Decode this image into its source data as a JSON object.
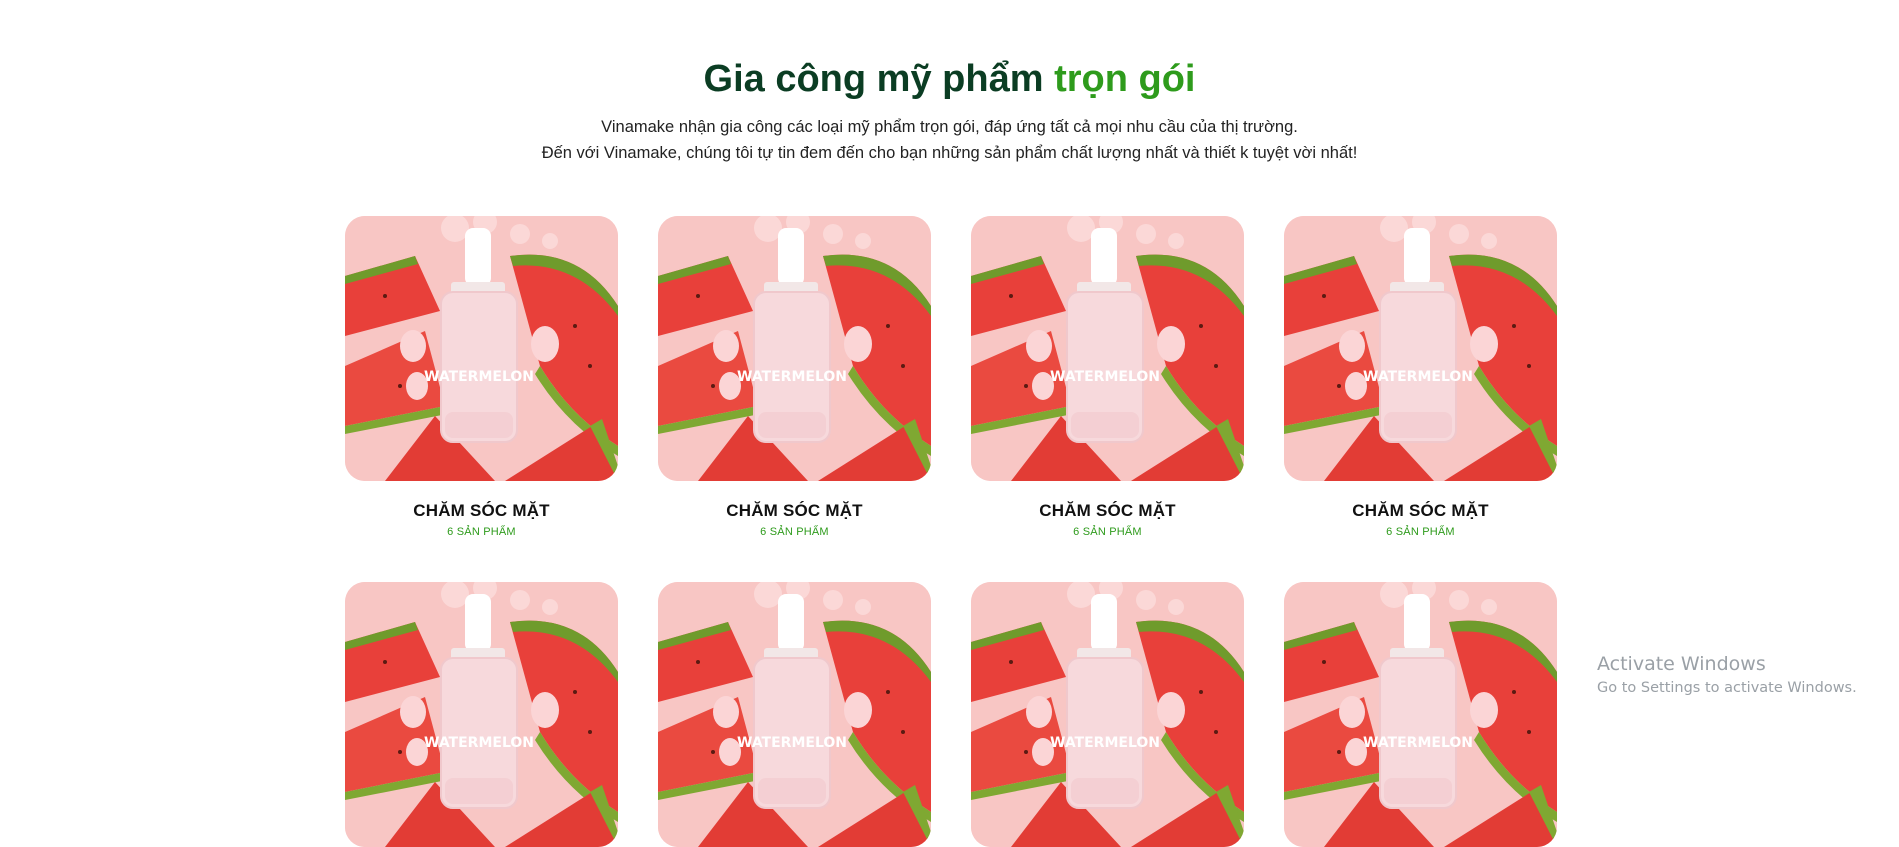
{
  "section": {
    "title_main": "Gia công mỹ phẩm",
    "title_accent": "trọn gói",
    "subtitle_line1": "Vinamake nhận gia công các loại mỹ phẩm trọn gói, đáp ứng tất cả mọi nhu cầu của thị trường.",
    "subtitle_line2": "Đến với Vinamake, chúng tôi tự tin đem đến cho bạn những sản phẩm chất lượng nhất và thiết k tuyệt vời nhất!"
  },
  "categories": [
    {
      "title": "CHĂM SÓC MẶT",
      "count": "6 SẢN PHẨM"
    },
    {
      "title": "CHĂM SÓC MẶT",
      "count": "6 SẢN PHẨM"
    },
    {
      "title": "CHĂM SÓC MẶT",
      "count": "6 SẢN PHẨM"
    },
    {
      "title": "CHĂM SÓC MẶT",
      "count": "6 SẢN PHẨM"
    },
    {
      "title": "",
      "count": ""
    },
    {
      "title": "",
      "count": ""
    },
    {
      "title": "",
      "count": ""
    },
    {
      "title": "",
      "count": ""
    }
  ],
  "product_image": {
    "bottle_text": "WATERMELON",
    "bg_color": "#f8c6c4",
    "melon_color": "#e8403a",
    "rind_color": "#6f9b2c"
  },
  "watermark": {
    "title": "Activate Windows",
    "subtitle": "Go to Settings to activate Windows."
  },
  "colors": {
    "heading": "#0b3d23",
    "accent": "#2e9b1c"
  }
}
